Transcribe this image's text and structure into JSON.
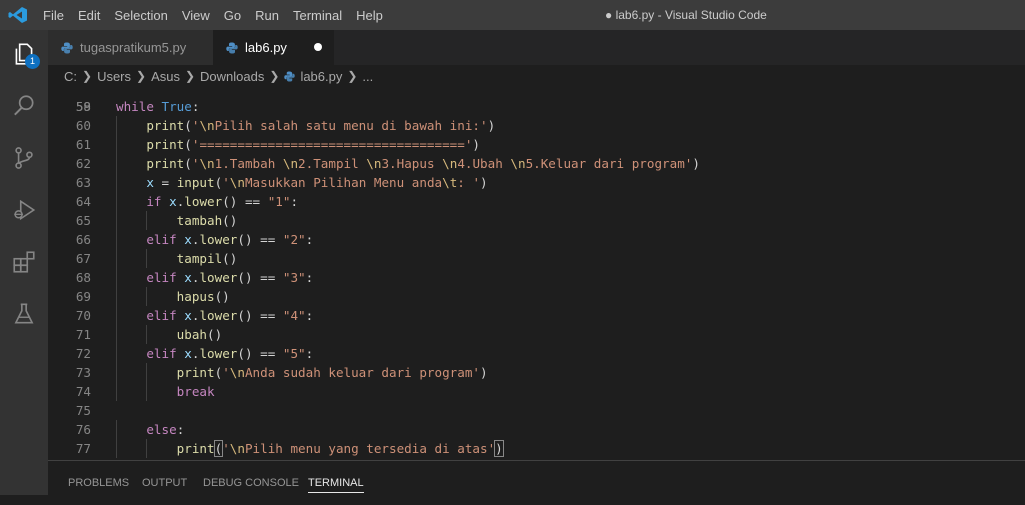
{
  "titlebar": {
    "menu": [
      "File",
      "Edit",
      "Selection",
      "View",
      "Go",
      "Run",
      "Terminal",
      "Help"
    ],
    "window_title": "● lab6.py - Visual Studio Code"
  },
  "activity": {
    "explorer_badge": "1",
    "icons": [
      "explorer-icon",
      "search-icon",
      "source-control-icon",
      "run-debug-icon",
      "extensions-icon",
      "testing-icon"
    ]
  },
  "tabs": [
    {
      "label": "tugaspratikum5.py",
      "active": false
    },
    {
      "label": "lab6.py",
      "active": true,
      "modified": true
    }
  ],
  "breadcrumb": [
    "C:",
    "Users",
    "Asus",
    "Downloads",
    "lab6.py",
    "..."
  ],
  "editor": {
    "first_line_partial": "58",
    "lines": [
      {
        "n": "59",
        "code": "while True:"
      },
      {
        "n": "60",
        "code": "    print('\\nPilih salah satu menu di bawah ini:')"
      },
      {
        "n": "61",
        "code": "    print('===================================')"
      },
      {
        "n": "62",
        "code": "    print('\\n1.Tambah \\n2.Tampil \\n3.Hapus \\n4.Ubah \\n5.Keluar dari program')"
      },
      {
        "n": "63",
        "code": "    x = input('\\nMasukkan Pilihan Menu anda\\t: ')"
      },
      {
        "n": "64",
        "code": "    if x.lower() == \"1\":"
      },
      {
        "n": "65",
        "code": "        tambah()"
      },
      {
        "n": "66",
        "code": "    elif x.lower() == \"2\":"
      },
      {
        "n": "67",
        "code": "        tampil()"
      },
      {
        "n": "68",
        "code": "    elif x.lower() == \"3\":"
      },
      {
        "n": "69",
        "code": "        hapus()"
      },
      {
        "n": "70",
        "code": "    elif x.lower() == \"4\":"
      },
      {
        "n": "71",
        "code": "        ubah()"
      },
      {
        "n": "72",
        "code": "    elif x.lower() == \"5\":"
      },
      {
        "n": "73",
        "code": "        print('\\nAnda sudah keluar dari program')"
      },
      {
        "n": "74",
        "code": "        break"
      },
      {
        "n": "75",
        "code": ""
      },
      {
        "n": "76",
        "code": "    else:"
      },
      {
        "n": "77",
        "code": "        print('\\nPilih menu yang tersedia di atas')"
      }
    ]
  },
  "panel": {
    "tabs": [
      "PROBLEMS",
      "OUTPUT",
      "DEBUG CONSOLE",
      "TERMINAL"
    ],
    "active": "TERMINAL"
  },
  "colors": {
    "keyword": "#c586c0",
    "constant": "#569cd6",
    "function": "#dcdcaa",
    "string": "#ce9178",
    "escape": "#d7ba7d",
    "variable": "#9cdcfe",
    "accent": "#0e70c0"
  }
}
